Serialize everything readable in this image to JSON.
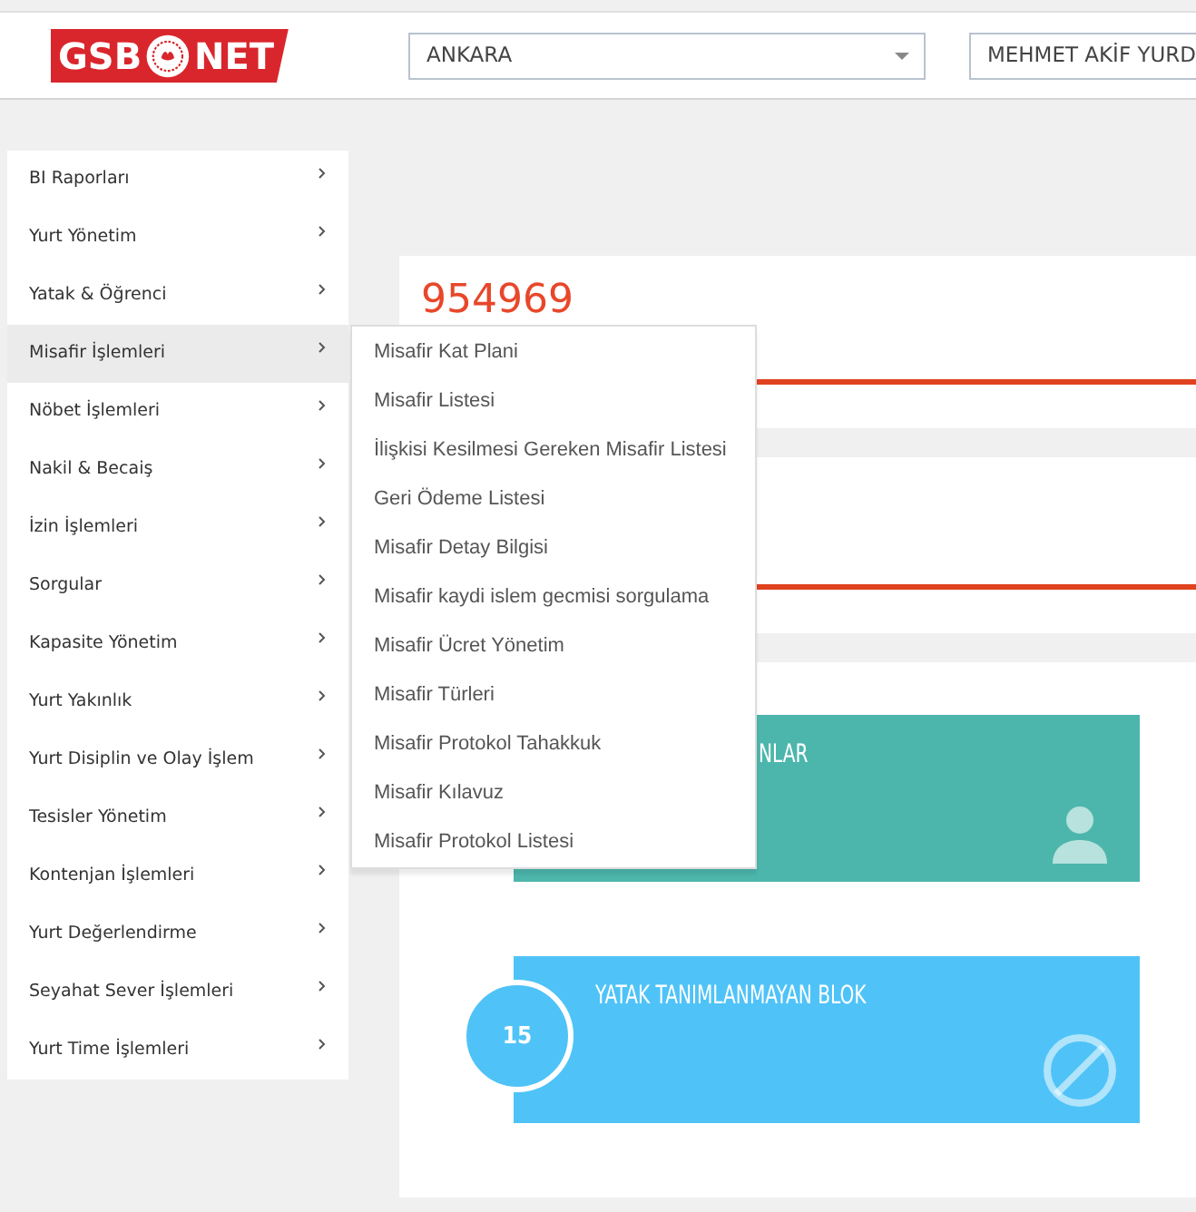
{
  "header": {
    "logo": {
      "left": "GSB",
      "right": "NET"
    },
    "selects": [
      {
        "value": "ANKARA",
        "kind": "dropdown"
      },
      {
        "value": "MEHMET AKİF YURD",
        "kind": "plain"
      }
    ]
  },
  "sidebar": {
    "items": [
      {
        "label": "BI Raporları",
        "selected": false
      },
      {
        "label": "Yurt Yönetim",
        "selected": false
      },
      {
        "label": "Yatak & Öğrenci",
        "selected": false
      },
      {
        "label": "Misafir İşlemleri",
        "selected": true
      },
      {
        "label": "Nöbet İşlemleri",
        "selected": false
      },
      {
        "label": "Nakil & Becaiş",
        "selected": false
      },
      {
        "label": "İzin İşlemleri",
        "selected": false
      },
      {
        "label": "Sorgular",
        "selected": false
      },
      {
        "label": "Kapasite Yönetim",
        "selected": false
      },
      {
        "label": "Yurt Yakınlık",
        "selected": false
      },
      {
        "label": "Yurt Disiplin ve Olay İşlem",
        "selected": false
      },
      {
        "label": "Tesisler Yönetim",
        "selected": false
      },
      {
        "label": "Kontenjan İşlemleri",
        "selected": false
      },
      {
        "label": "Yurt Değerlendirme",
        "selected": false
      },
      {
        "label": "Seyahat Sever İşlemleri",
        "selected": false
      },
      {
        "label": "Yurt Time İşlemleri",
        "selected": false
      }
    ]
  },
  "submenu": {
    "items": [
      "Misafir Kat Plani",
      "Misafir Listesi",
      "İlişkisi Kesilmesi Gereken Misafir Listesi",
      "Geri Ödeme Listesi",
      "Misafir Detay Bilgisi",
      "Misafir kaydi islem gecmisi sorgulama",
      "Misafir Ücret Yönetim",
      "Misafir Türleri",
      "Misafir Protokol Tahakkuk",
      "Misafir Kılavuz",
      "Misafir Protokol Listesi"
    ]
  },
  "main": {
    "number": "954969",
    "tiles": [
      {
        "title": "NLAR",
        "color": "#4db6ac",
        "kind": "person"
      },
      {
        "title": "YATAK TANIMLANMAYAN BLOK",
        "count": "15",
        "color": "#4fc3f7",
        "kind": "ban"
      }
    ]
  }
}
